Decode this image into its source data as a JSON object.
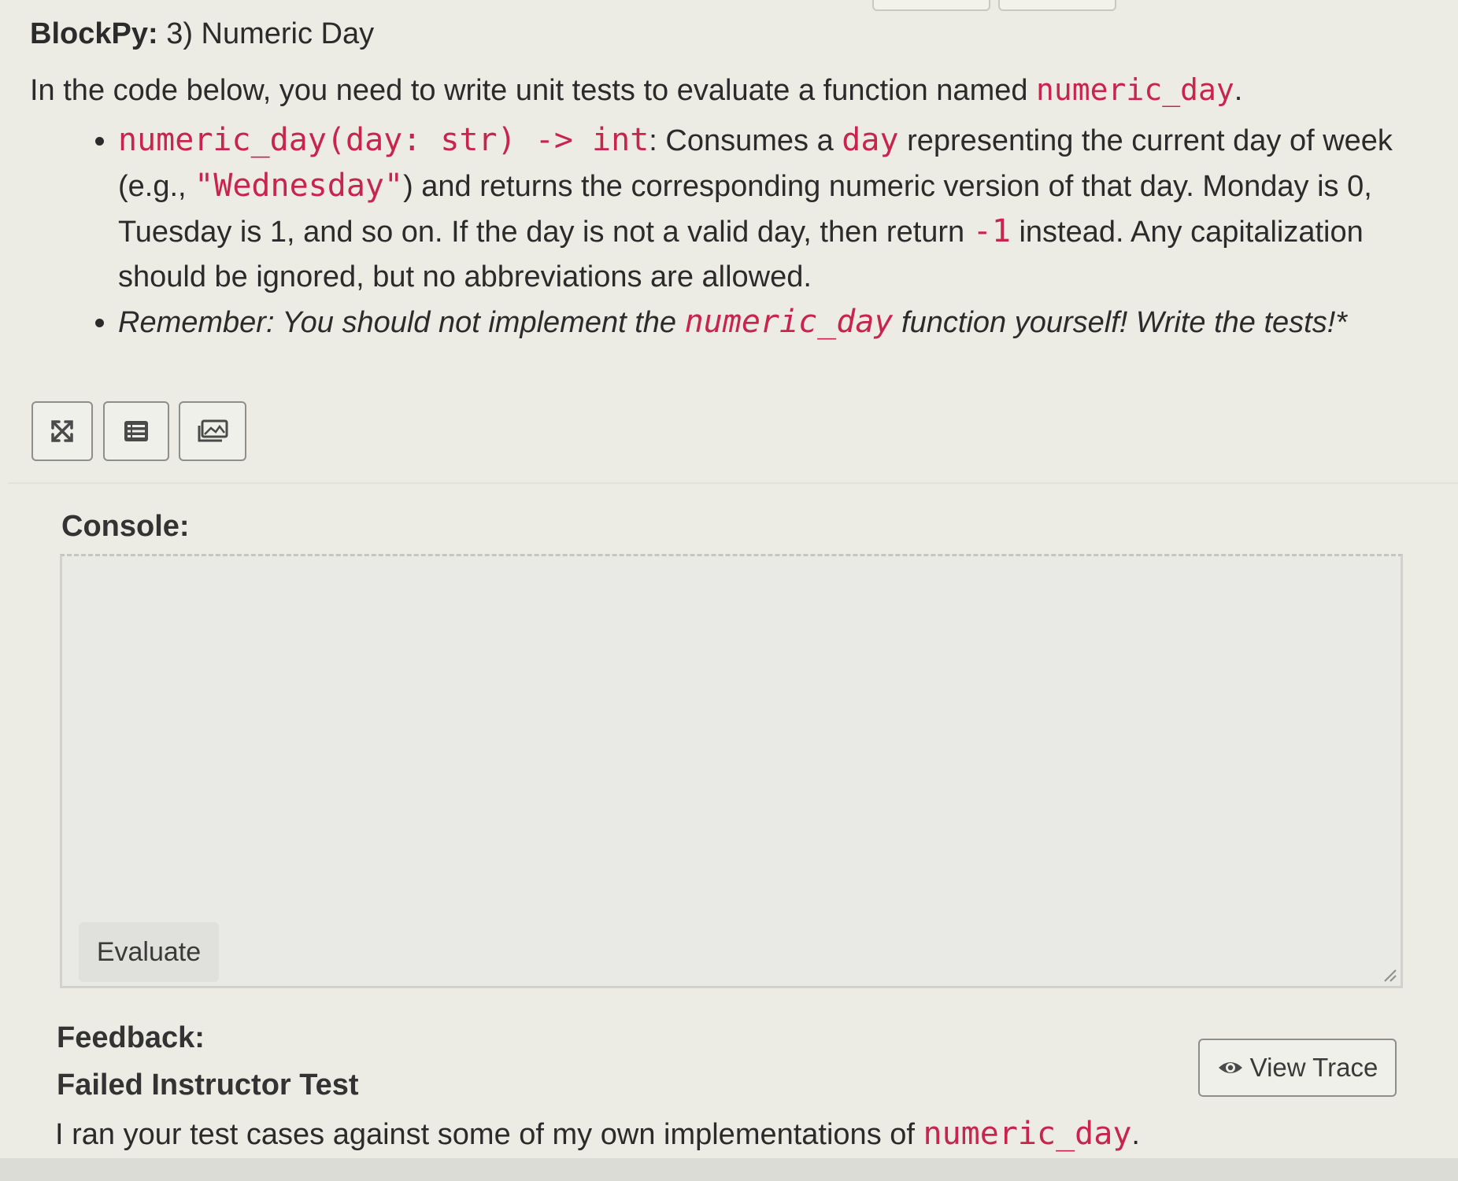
{
  "header": {
    "app_name": "BlockPy:",
    "problem_title": "3) Numeric Day"
  },
  "intro": {
    "text": "In the code below, you need to write unit tests to evaluate a function named ",
    "function_name": "numeric_day",
    "end": "."
  },
  "instructions": [
    {
      "signature": "numeric_day(day: str) -> int",
      "t1": ": Consumes a ",
      "param": "day",
      "t2": " representing the current day of week (e.g., ",
      "example": "\"Wednesday\"",
      "t3": ") and returns the corresponding numeric version of that day. Monday is 0, Tuesday is 1, and so on. If the day is not a valid day, then return ",
      "invalid_value": "-1",
      "t4": " instead. Any capitalization should be ignored, but no abbreviations are allowed."
    },
    {
      "t1": "Remember: You should not implement the ",
      "function_name": "numeric_day",
      "t2": " function yourself! Write the tests!*"
    }
  ],
  "toolbar": {
    "icons": [
      "fullscreen-icon",
      "list-icon",
      "image-icon"
    ]
  },
  "console": {
    "label": "Console:",
    "evaluate_label": "Evaluate"
  },
  "feedback": {
    "label": "Feedback:",
    "title": "Failed Instructor Test",
    "message": "I ran your test cases against some of my own implementations of ",
    "function_name": "numeric_day",
    "end": ".",
    "view_trace_label": "View Trace"
  },
  "colors": {
    "code": "#c7254e",
    "background": "#ecece4",
    "text": "#2b2b2b"
  }
}
